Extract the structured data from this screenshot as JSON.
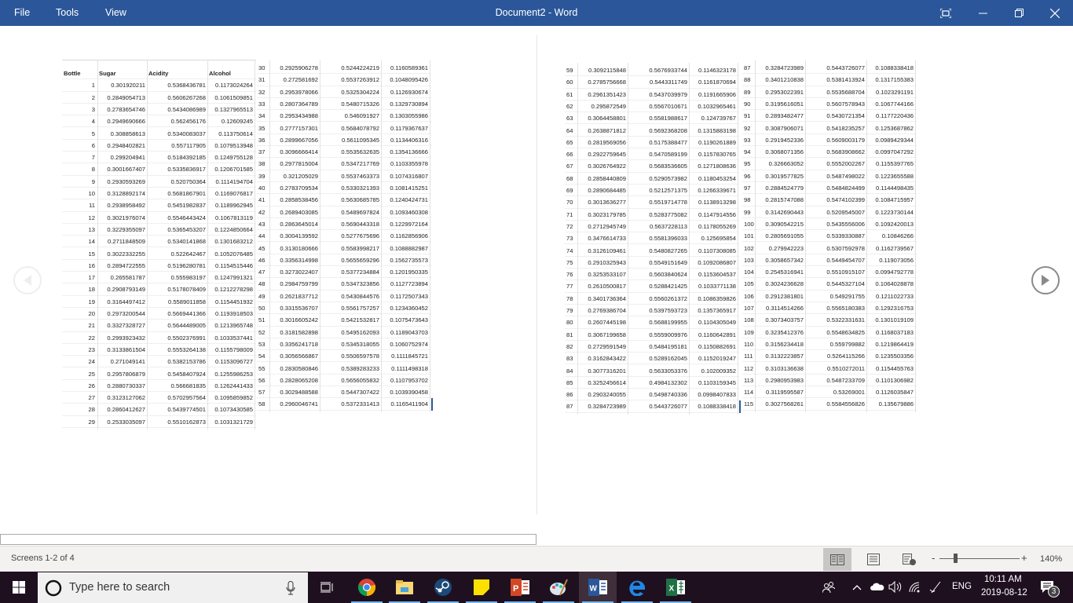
{
  "titlebar": {
    "menu": [
      "File",
      "Tools",
      "View"
    ],
    "title": "Document2  -  Word",
    "buttons": [
      "focus-mode",
      "minimize",
      "restore",
      "close"
    ]
  },
  "table": {
    "headers": [
      "Bottle",
      "Sugar",
      "Acidity",
      "Alcohol"
    ],
    "rows": [
      [
        "1",
        "0.301920211",
        "0.5368436781",
        "0.1173024264"
      ],
      [
        "2",
        "0.2849054713",
        "0.5606267268",
        "0.1061509851"
      ],
      [
        "3",
        "0.2783654746",
        "0.5434086989",
        "0.1327965513"
      ],
      [
        "4",
        "0.2949690666",
        "0.562456176",
        "0.12609245"
      ],
      [
        "5",
        "0.308858613",
        "0.5340083037",
        "0.113750614"
      ],
      [
        "6",
        "0.2948402821",
        "0.557117905",
        "0.1079513948"
      ],
      [
        "7",
        "0.299204941",
        "0.5184392185",
        "0.1249755128"
      ],
      [
        "8",
        "0.3001667407",
        "0.5335836917",
        "0.1206701585"
      ],
      [
        "9",
        "0.2930593269",
        "0.520750364",
        "0.1114194704"
      ],
      [
        "10",
        "0.3128892174",
        "0.5681867901",
        "0.1169076817"
      ],
      [
        "11",
        "0.2938958492",
        "0.5451982837",
        "0.1189962945"
      ],
      [
        "12",
        "0.3021976074",
        "0.5546443424",
        "0.1067813119"
      ],
      [
        "13",
        "0.3229355097",
        "0.5365453207",
        "0.1224850664"
      ],
      [
        "14",
        "0.2711848509",
        "0.5340141868",
        "0.1301683212"
      ],
      [
        "15",
        "0.3022332255",
        "0.522642467",
        "0.1052076485"
      ],
      [
        "16",
        "0.2894722555",
        "0.5196280781",
        "0.1154515446"
      ],
      [
        "17",
        "0.265581787",
        "0.555983197",
        "0.1247991321"
      ],
      [
        "18",
        "0.2908793149",
        "0.5178078409",
        "0.1212278298"
      ],
      [
        "19",
        "0.3164497412",
        "0.5589011858",
        "0.1154451932"
      ],
      [
        "20",
        "0.2973200544",
        "0.5669441366",
        "0.1193918503"
      ],
      [
        "21",
        "0.3327328727",
        "0.5644489005",
        "0.1213965748"
      ],
      [
        "22",
        "0.2993923432",
        "0.5502376991",
        "0.1033537441"
      ],
      [
        "23",
        "0.3133861504",
        "0.5553264138",
        "0.1155798009"
      ],
      [
        "24",
        "0.271049141",
        "0.5382153786",
        "0.1153096727"
      ],
      [
        "25",
        "0.2957806879",
        "0.5458407924",
        "0.1255986253"
      ],
      [
        "26",
        "0.2880730337",
        "0.566681835",
        "0.1262441433"
      ],
      [
        "27",
        "0.3123127062",
        "0.5702957564",
        "0.1095859852"
      ],
      [
        "28",
        "0.2860412627",
        "0.5439774501",
        "0.1073430585"
      ],
      [
        "29",
        "0.2533035097",
        "0.5510162873",
        "0.1031321729"
      ],
      [
        "30",
        "0.2925906278",
        "0.5244224219",
        "0.1160589361"
      ],
      [
        "31",
        "0.272581692",
        "0.5537263912",
        "0.1048095426"
      ],
      [
        "32",
        "0.2953978066",
        "0.5325304224",
        "0.1126930674"
      ],
      [
        "33",
        "0.2807364789",
        "0.5480715326",
        "0.1329730894"
      ],
      [
        "34",
        "0.2953434988",
        "0.546091927",
        "0.1303055986"
      ],
      [
        "35",
        "0.2777157301",
        "0.5684078792",
        "0.1179367637"
      ],
      [
        "36",
        "0.2899667056",
        "0.5611095345",
        "0.1134406316"
      ],
      [
        "37",
        "0.3096666414",
        "0.5535632635",
        "0.1354136666"
      ],
      [
        "38",
        "0.2977815004",
        "0.5347217769",
        "0.1103355978"
      ],
      [
        "39",
        "0.321205029",
        "0.5537463373",
        "0.1074316807"
      ],
      [
        "40",
        "0.2783709534",
        "0.5330321393",
        "0.1081415251"
      ],
      [
        "41",
        "0.2858538456",
        "0.5630685785",
        "0.1240424731"
      ],
      [
        "42",
        "0.2689403085",
        "0.5489697824",
        "0.1093460308"
      ],
      [
        "43",
        "0.2863645014",
        "0.5690443318",
        "0.1229972164"
      ],
      [
        "44",
        "0.3004139592",
        "0.5277675696",
        "0.1162856906"
      ],
      [
        "45",
        "0.3130180666",
        "0.5583998217",
        "0.1088882987"
      ],
      [
        "46",
        "0.3356314998",
        "0.5655659296",
        "0.1562735573"
      ],
      [
        "47",
        "0.3273022407",
        "0.5377234884",
        "0.1201950335"
      ],
      [
        "48",
        "0.2984759799",
        "0.5347323856",
        "0.1127723894"
      ],
      [
        "49",
        "0.2621837712",
        "0.5430844576",
        "0.1172507343"
      ],
      [
        "50",
        "0.3315536707",
        "0.5561757257",
        "0.1234360452"
      ],
      [
        "51",
        "0.3016605242",
        "0.5421532817",
        "0.1075473643"
      ],
      [
        "52",
        "0.3181582898",
        "0.5495162093",
        "0.1189043703"
      ],
      [
        "53",
        "0.3356241718",
        "0.5345318055",
        "0.1060752974"
      ],
      [
        "54",
        "0.3056566867",
        "0.5506597578",
        "0.1111845721"
      ],
      [
        "55",
        "0.2830580846",
        "0.5389283233",
        "0.1111498318"
      ],
      [
        "56",
        "0.2828065208",
        "0.5656055832",
        "0.1107953702"
      ],
      [
        "57",
        "0.3029488588",
        "0.5447307422",
        "0.1039390458"
      ],
      [
        "58",
        "0.2960046741",
        "0.5372331413",
        "0.1165411904"
      ],
      [
        "59",
        "0.3092115848",
        "0.5676933744",
        "0.1146323178"
      ],
      [
        "60",
        "0.2785756668",
        "0.5443311749",
        "0.1161870694"
      ],
      [
        "61",
        "0.2961351423",
        "0.5437039979",
        "0.1191665906"
      ],
      [
        "62",
        "0.295872549",
        "0.5567010671",
        "0.1032965461"
      ],
      [
        "63",
        "0.3064458801",
        "0.5581988617",
        "0.124739767"
      ],
      [
        "64",
        "0.2638871812",
        "0.5692368208",
        "0.1315883198"
      ],
      [
        "65",
        "0.2819569056",
        "0.5175388477",
        "0.1190261889"
      ],
      [
        "66",
        "0.2922759645",
        "0.5470589199",
        "0.1157830765"
      ],
      [
        "67",
        "0.3026764922",
        "0.5683536605",
        "0.1271808636"
      ],
      [
        "68",
        "0.2858440809",
        "0.5290573982",
        "0.1180453254"
      ],
      [
        "69",
        "0.2890684485",
        "0.5212571375",
        "0.1266339671"
      ],
      [
        "70",
        "0.3013636277",
        "0.5519714778",
        "0.1138913298"
      ],
      [
        "71",
        "0.3023179785",
        "0.5283775082",
        "0.1147914556"
      ],
      [
        "72",
        "0.2712945749",
        "0.5637228113",
        "0.1178055269"
      ],
      [
        "73",
        "0.3476614733",
        "0.5581396033",
        "0.125695854"
      ],
      [
        "74",
        "0.3126109461",
        "0.5480827265",
        "0.1107308085"
      ],
      [
        "75",
        "0.2910325943",
        "0.5549151649",
        "0.1092086807"
      ],
      [
        "76",
        "0.3253533107",
        "0.5603840624",
        "0.1153604537"
      ],
      [
        "77",
        "0.2610500817",
        "0.5288421425",
        "0.1033771138"
      ],
      [
        "78",
        "0.3401736364",
        "0.5560261372",
        "0.1086359826"
      ],
      [
        "79",
        "0.2769386704",
        "0.5397593723",
        "0.1357365917"
      ],
      [
        "80",
        "0.2607445198",
        "0.5688199955",
        "0.1104305049"
      ],
      [
        "81",
        "0.3067199658",
        "0.5559009976",
        "0.1160642891"
      ],
      [
        "82",
        "0.2729591549",
        "0.5484195181",
        "0.1150882691"
      ],
      [
        "83",
        "0.3162843422",
        "0.5289162045",
        "0.1152019247"
      ],
      [
        "84",
        "0.3077316201",
        "0.5633053376",
        "0.102009352"
      ],
      [
        "85",
        "0.3252456614",
        "0.4984132302",
        "0.1103159345"
      ],
      [
        "86",
        "0.2903240055",
        "0.5498740336",
        "0.0998407833"
      ],
      [
        "87",
        "0.3284723989",
        "0.5443726077",
        "0.1088338418"
      ],
      [
        "88",
        "0.3401210838",
        "0.5381413924",
        "0.1317155383"
      ],
      [
        "89",
        "0.2953022391",
        "0.5535688704",
        "0.1023291191"
      ],
      [
        "90",
        "0.3195616051",
        "0.5607578943",
        "0.1067744166"
      ],
      [
        "91",
        "0.2893482477",
        "0.5430721354",
        "0.1177220436"
      ],
      [
        "92",
        "0.3087906071",
        "0.5418235257",
        "0.1253687862"
      ],
      [
        "93",
        "0.2919452336",
        "0.5609003179",
        "0.0989429344"
      ],
      [
        "94",
        "0.3068071356",
        "0.5683908662",
        "0.0997047292"
      ],
      [
        "95",
        "0.326663052",
        "0.5552002267",
        "0.1155397765"
      ],
      [
        "96",
        "0.3019577825",
        "0.5487498022",
        "0.1223655588"
      ],
      [
        "97",
        "0.2884524779",
        "0.5484824499",
        "0.1144498435"
      ],
      [
        "98",
        "0.2815747088",
        "0.5474102399",
        "0.1084715957"
      ],
      [
        "99",
        "0.3142690443",
        "0.5209545007",
        "0.1223730144"
      ],
      [
        "100",
        "0.3090542215",
        "0.5435556006",
        "0.1092420013"
      ],
      [
        "101",
        "0.2805691055",
        "0.5339330887",
        "0.10846266"
      ],
      [
        "102",
        "0.279942223",
        "0.5307592978",
        "0.1162739567"
      ],
      [
        "103",
        "0.3058657342",
        "0.5449454707",
        "0.119073056"
      ],
      [
        "104",
        "0.2545316941",
        "0.5510915107",
        "0.0994792778"
      ],
      [
        "105",
        "0.3024236628",
        "0.5445327104",
        "0.1064028878"
      ],
      [
        "106",
        "0.2912381801",
        "0.549291755",
        "0.1211022733"
      ],
      [
        "107",
        "0.3114514266",
        "0.5565180383",
        "0.1292316753"
      ],
      [
        "108",
        "0.3073403757",
        "0.5322331631",
        "0.1301019109"
      ],
      [
        "109",
        "0.3235412376",
        "0.5548634825",
        "0.1168037183"
      ],
      [
        "110",
        "0.3156234418",
        "0.559799882",
        "0.1219864419"
      ],
      [
        "111",
        "0.3132223857",
        "0.5264115266",
        "0.1235503356"
      ],
      [
        "112",
        "0.3103136638",
        "0.5510272011",
        "0.1154455763"
      ],
      [
        "113",
        "0.2980953983",
        "0.5487233709",
        "0.1101306982"
      ],
      [
        "114",
        "0.3119595587",
        "0.53269001",
        "0.1126035847"
      ],
      [
        "115",
        "0.3027568261",
        "0.5584556826",
        "0.135679886"
      ]
    ]
  },
  "statusbar": {
    "screens": "Screens 1-2 of 4",
    "zoom": "140%",
    "zoom_minus": "-",
    "zoom_plus": "+",
    "views": [
      "read-mode",
      "print-layout",
      "web-layout"
    ],
    "active_view": "read-mode"
  },
  "taskbar": {
    "search_placeholder": "Type here to search",
    "apps": [
      "Task View",
      "Chrome",
      "File Explorer",
      "Steam",
      "Sticky Notes",
      "PowerPoint",
      "Paint",
      "Word",
      "Edge",
      "Excel"
    ],
    "active_app": "Word",
    "language": "ENG",
    "time": "10:11 AM",
    "date": "2019-08-12",
    "notifications": "3"
  },
  "colors": {
    "word_blue": "#2b579a",
    "taskbar": "#1f1020",
    "statusbar": "#f3f2f1"
  }
}
